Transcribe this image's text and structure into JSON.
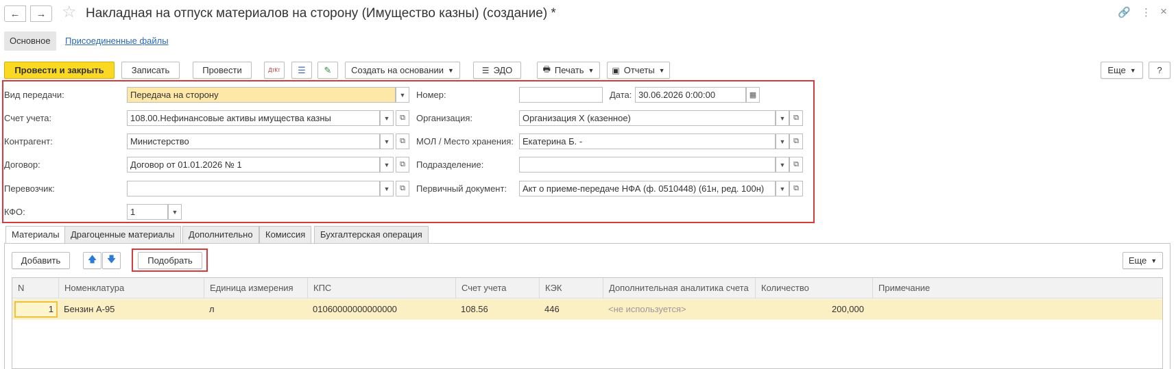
{
  "window": {
    "title": "Накладная на отпуск материалов на сторону (Имущество казны) (создание) *",
    "back_icon": "←",
    "fwd_icon": "→",
    "star_icon": "☆",
    "link_icon": "🔗",
    "menu_icon": "⋮",
    "close_icon": "×"
  },
  "sections": {
    "main": "Основное",
    "files": "Присоединенные файлы"
  },
  "toolbar": {
    "post_close": "Провести и закрыть",
    "save": "Записать",
    "post": "Провести",
    "dt_kt_icon": "ДтКт",
    "report_icon": "☰",
    "sign_icon": "✎",
    "create_based": "Создать на основании",
    "edo": "ЭДО",
    "print": "Печать",
    "reports": "Отчеты",
    "more": "Еще",
    "help": "?"
  },
  "form": {
    "transfer_type_label": "Вид передачи:",
    "transfer_type_value": "Передача на сторону",
    "account_label": "Счет учета:",
    "account_value": "108.00.Нефинансовые активы имущества казны",
    "counterparty_label": "Контрагент:",
    "counterparty_value": "Министерство",
    "contract_label": "Договор:",
    "contract_value": "Договор от 01.01.2026 № 1",
    "carrier_label": "Перевозчик:",
    "carrier_value": "",
    "kfo_label": "КФО:",
    "kfo_value": "1",
    "number_label": "Номер:",
    "number_value": "",
    "date_label": "Дата:",
    "date_value": "30.06.2026  0:00:00",
    "org_label": "Организация:",
    "org_value": "Организация Х (казенное)",
    "mol_label": "МОЛ / Место хранения:",
    "mol_value": "Екатерина Б. -",
    "dept_label": "Подразделение:",
    "dept_value": "",
    "primary_doc_label": "Первичный документ:",
    "primary_doc_value": "Акт о приеме-передаче НФА (ф. 0510448) (61н, ред. 100н)"
  },
  "tabs": [
    "Материалы",
    "Драгоценные материалы",
    "Дополнительно",
    "Комиссия",
    "Бухгалтерская операция"
  ],
  "table_toolbar": {
    "add": "Добавить",
    "up_icon": "🡅",
    "down_icon": "🡇",
    "pick": "Подобрать",
    "more": "Еще"
  },
  "table": {
    "headers": [
      "N",
      "Номенклатура",
      "Единица измерения",
      "КПС",
      "Счет учета",
      "КЭК",
      "Дополнительная аналитика счета",
      "Количество",
      "Примечание"
    ],
    "rows": [
      {
        "n": "1",
        "nomenclature": "Бензин А-95",
        "unit": "л",
        "kps": "01060000000000000",
        "account": "108.56",
        "kek": "446",
        "analytics": "<не используется>",
        "quantity": "200,000",
        "note": ""
      }
    ]
  },
  "colors": {
    "primary_button": "#fbd822",
    "highlight_box": "#d63a3a",
    "selected_row": "#fbf0c3",
    "link": "#2a68b5"
  }
}
